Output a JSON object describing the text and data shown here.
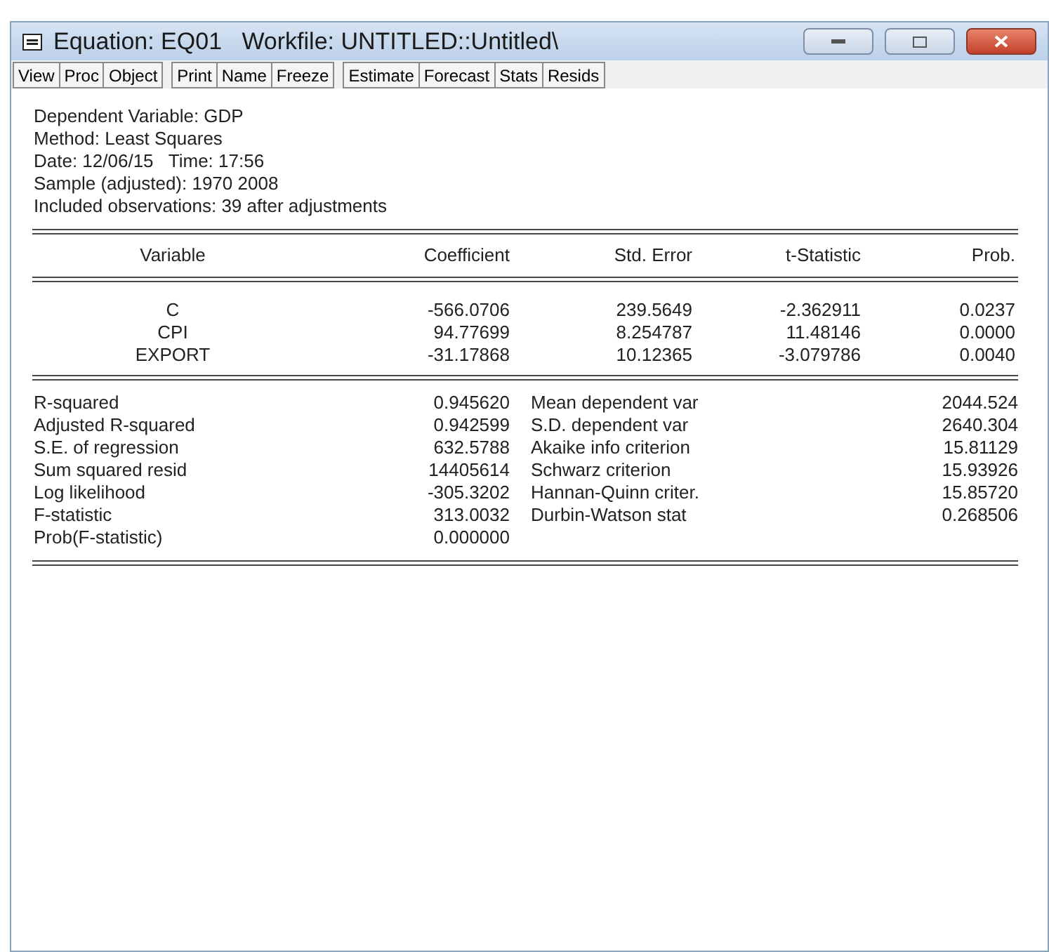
{
  "window": {
    "title": "Equation: EQ01   Workfile: UNTITLED::Untitled\\"
  },
  "toolbar": [
    [
      "View",
      "Proc",
      "Object"
    ],
    [
      "Print",
      "Name",
      "Freeze"
    ],
    [
      "Estimate",
      "Forecast",
      "Stats",
      "Resids"
    ]
  ],
  "header": [
    "Dependent Variable: GDP",
    "Method: Least Squares",
    "Date: 12/06/15   Time: 17:56",
    "Sample (adjusted): 1970 2008",
    "Included observations: 39 after adjustments"
  ],
  "table": {
    "columns": [
      "Variable",
      "Coefficient",
      "Std. Error",
      "t-Statistic",
      "Prob."
    ],
    "rows": [
      [
        "C",
        "-566.0706",
        "239.5649",
        "-2.362911",
        "0.0237"
      ],
      [
        "CPI",
        "94.77699",
        "8.254787",
        "11.48146",
        "0.0000"
      ],
      [
        "EXPORT",
        "-31.17868",
        "10.12365",
        "-3.079786",
        "0.0040"
      ]
    ]
  },
  "stats": [
    [
      "R-squared",
      "0.945620",
      "Mean dependent var",
      "2044.524"
    ],
    [
      "Adjusted R-squared",
      "0.942599",
      "S.D. dependent var",
      "2640.304"
    ],
    [
      "S.E. of regression",
      "632.5788",
      "Akaike info criterion",
      "15.81129"
    ],
    [
      "Sum squared resid",
      "14405614",
      "Schwarz criterion",
      "15.93926"
    ],
    [
      "Log likelihood",
      "-305.3202",
      "Hannan-Quinn criter.",
      "15.85720"
    ],
    [
      "F-statistic",
      "313.0032",
      "Durbin-Watson stat",
      "0.268506"
    ],
    [
      "Prob(F-statistic)",
      "0.000000"
    ]
  ]
}
